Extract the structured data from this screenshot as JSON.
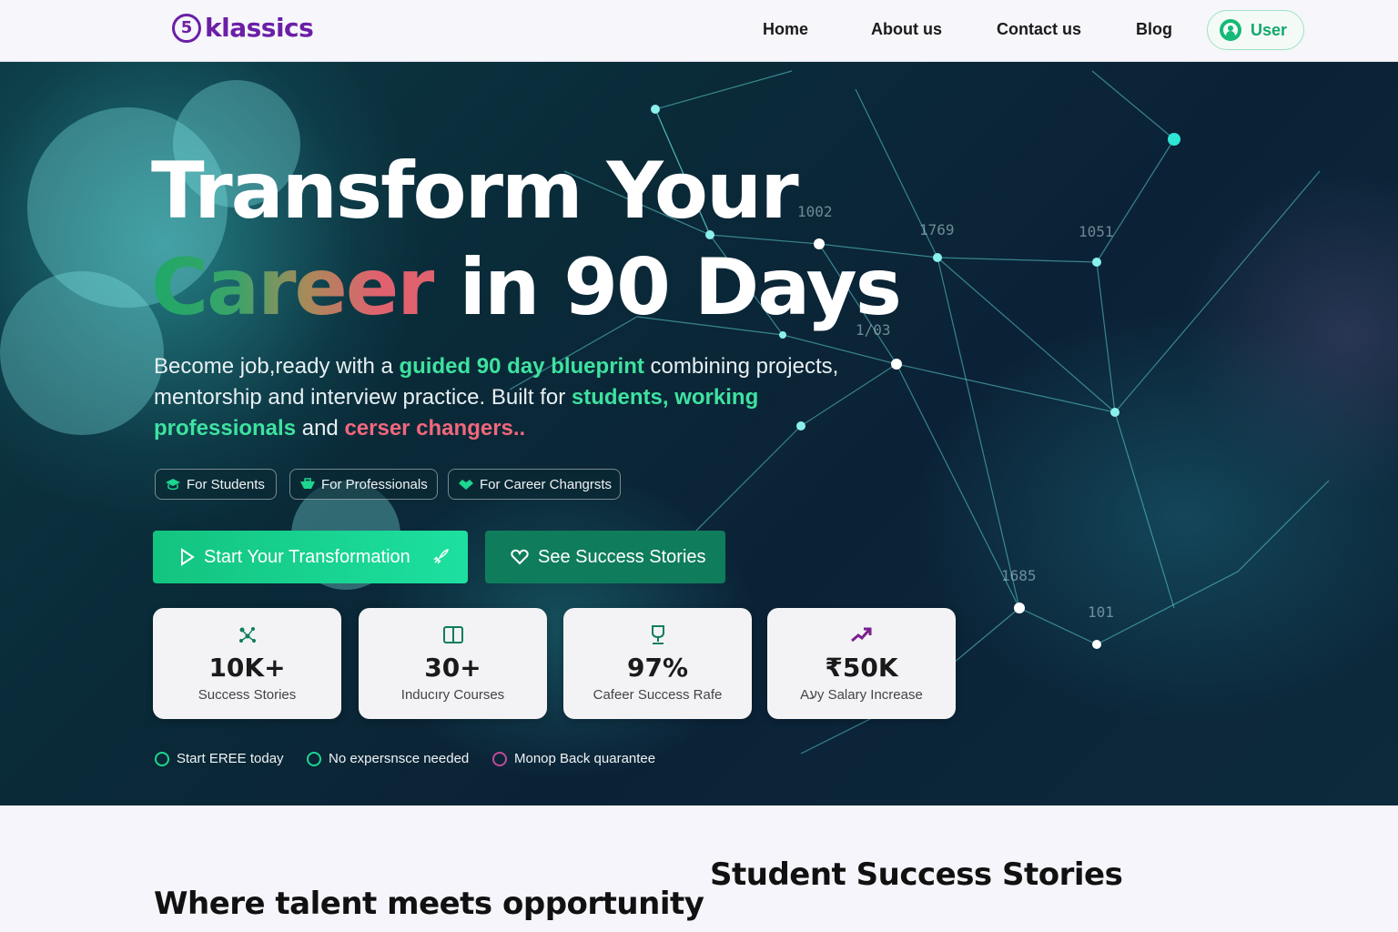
{
  "nav": {
    "logo_mark": "5",
    "logo_text": "klassics",
    "links": [
      "Home",
      "About us",
      "Contact us",
      "Blog"
    ],
    "user_label": "User"
  },
  "hero": {
    "title_line1": "Transform Your",
    "title_career": "Career",
    "title_line2_rest": "in 90 Days",
    "desc_1": "Become job,ready with a ",
    "desc_hl1": "guided 90 day blueprint",
    "desc_2": " combining projects, mentorship and interview practice. Built for ",
    "desc_hl2": "students, working professionals",
    "desc_3": " and ",
    "desc_hl3": "cerser changers..",
    "tags": [
      "For Students",
      "For Professionals",
      "For Career Changrsts"
    ],
    "primary_button": "Start Your Transformation",
    "secondary_button": "See Success Stories",
    "stats": [
      {
        "value": "10K+",
        "label": "Success Stories",
        "icon": "network-icon",
        "color": "#0f7d5c"
      },
      {
        "value": "30+",
        "label": "Inducıry Courses",
        "icon": "book-icon",
        "color": "#0f7d5c"
      },
      {
        "value": "97%",
        "label": "Cafeer Success Rafe",
        "icon": "trophy-icon",
        "color": "#0f7d5c"
      },
      {
        "value": "₹50K",
        "label": "Aעy Salary Increase",
        "icon": "trend-up-icon",
        "color": "#7a1f8f"
      }
    ],
    "perks": [
      {
        "label": "Start EREE today",
        "icon": "dollar-icon",
        "color": "#1dd68f"
      },
      {
        "label": "No expersnsce needed",
        "icon": "check-circle-icon",
        "color": "#1dd68f"
      },
      {
        "label": "Monop Back quarantee",
        "icon": "shield-icon",
        "color": "#c04a9a"
      }
    ]
  },
  "bottom": {
    "talent_heading": "Where talent meets opportunity",
    "stories_heading": "Student Success Stories"
  },
  "colors": {
    "brand": "#6b1fa6",
    "accent_green": "#13c47f",
    "accent_pink": "#f2677c"
  }
}
